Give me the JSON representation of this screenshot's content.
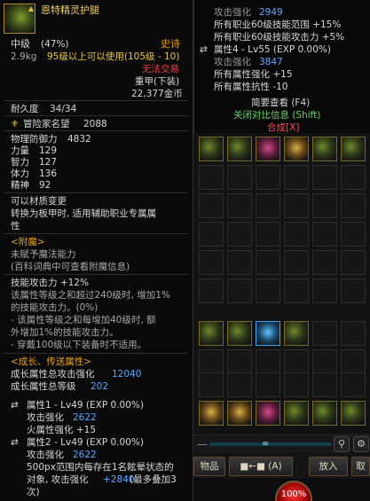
{
  "item": {
    "name": "恩特精灵护腿",
    "level_grade": "中级",
    "grade_percent": "(47%)",
    "rarity": "史诗",
    "weight": "2.9kg",
    "usable_level": "95级以上可以使用(105级 - 10)",
    "trade_status": "无法交易",
    "armor_type": "重甲(下装)",
    "price": "22,377金币",
    "durability_label": "耐久度",
    "durability_value": "34/34",
    "adventurer_fame_label": "冒险家名望",
    "adventurer_fame_value": "2088"
  },
  "stats": [
    {
      "label": "物理防御力",
      "value": "4832"
    },
    {
      "label": "力量",
      "value": "129"
    },
    {
      "label": "智力",
      "value": "127"
    },
    {
      "label": "体力",
      "value": "136"
    },
    {
      "label": "精神",
      "value": "92"
    }
  ],
  "material": {
    "line1": "可以材质变更",
    "line2": "转换为板甲时, 适用辅助职业专属属",
    "line3": "性"
  },
  "enchant": {
    "header": "<附魔>",
    "line1": "未赋予魔法能力",
    "line2": "(百科词典中可查看附魔信息)"
  },
  "skill_attack": {
    "title": "技能攻击力 +12%",
    "line1": "该属性等级之和超过240级时, 增加1%",
    "line2": "的技能攻击力。(0%)",
    "line3": "- 该属性等级之和每增加40级时, 额",
    "line4": "外增加1%的技能攻击力。",
    "line5": "- 穿戴100级以下装备时不适用。"
  },
  "growth": {
    "header": "<成长、传送属性>",
    "total_attack_label": "成长属性总攻击强化",
    "total_attack_value": "12040",
    "total_level_label": "成长属性总等级",
    "total_level_value": "202",
    "attr1_title": "属性1 - Lv49 (EXP 0.00%)",
    "attr1_attack_label": "攻击强化",
    "attr1_attack_value": "2622",
    "attr1_fire": "火属性强化 +15",
    "attr2_title": "属性2 - Lv49 (EXP 0.00%)",
    "attr2_attack_label": "攻击强化",
    "attr2_attack_value": "2622",
    "attr2_desc1": "500px范围内每存在1名眩晕状态的",
    "attr2_desc2_a": "对象, 攻击强化",
    "attr2_desc2_b": "+2840",
    "attr2_desc2_c": "(最多叠加3",
    "attr2_desc3": "次)"
  },
  "compare": {
    "line1_label": "攻击强化",
    "line1_value": "2949",
    "line2": "所有职业60级技能范围 +15%",
    "line3": "所有职业60级技能攻击力 +5%",
    "line4": "属性4 - Lv55 (EXP 0.00%)",
    "line5_label": "攻击强化",
    "line5_value": "3847",
    "line6": "所有属性强化 +15",
    "line7": "所有属性抗性 -10",
    "line8": "简要查看 (F4)",
    "line9": "关闭对比信息 (Shift)",
    "line10": "合成[X]"
  },
  "inventory": {
    "scroll_thumb": "∞",
    "btn_items": "物品",
    "btn_transfer": "(A)",
    "btn_put": "放入",
    "btn_last": "取",
    "hp_value": "100%"
  },
  "colors": {
    "accent_gold": "#e8c840",
    "orange_rarity": "#e8a020",
    "stat_blue": "#5aa8ff",
    "bonus_green": "#5cd45c",
    "warning_red": "#ff3c3c"
  }
}
